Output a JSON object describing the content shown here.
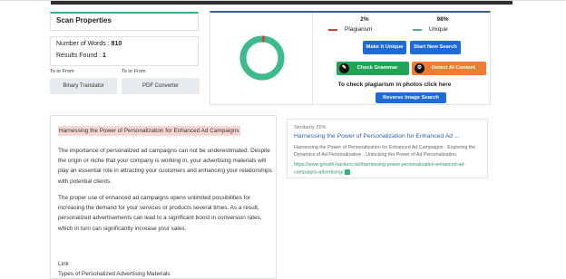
{
  "scan": {
    "title": "Scan Properties",
    "words_label": "Number of Words : ",
    "words_value": "810",
    "results_label": "Results Found : ",
    "results_value": "1",
    "to_or_from": "To or From",
    "binary_translator": "Binary Translator",
    "pdf_converter": "PDF Converter"
  },
  "results": {
    "plagiarism_pct": "2%",
    "unique_pct": "98%",
    "plagiarism_fraction": 0.02,
    "plagiarism_label": "Plagiarism",
    "unique_label": "Unique",
    "make_unique": "Make it Unique",
    "start_new_search": "Start New Search",
    "check_grammar": "Check Grammar",
    "detect_ai": "Detect AI Content",
    "photo_text": "To check plagiarism in photos click here",
    "reverse_image_search": "Reverse Image Search",
    "colors": {
      "plagiarism": "#e53935",
      "unique": "#3dbb8c",
      "blue_button": "#1e6bd6",
      "green_button": "#21a456",
      "orange_button": "#f07c32"
    }
  },
  "content": {
    "highlight": "Harnessing the Power of Personalization for Enhanced Ad Campaigns",
    "para1": "The importance of personalized ad campaigns can not be underestimated. Despite the origin or niche that your company is working in, your advertising materials will play an essential role in attracting your customers and enhancing your relationships with potential clients.",
    "para2": "The proper use of enhanced ad campaigns opens unlimited possibilities for increasing the demand for your services or products several times. As a result, personalized advertisements can lead to a significant boost in conversion rates, which in turn can significantly increase your sales.",
    "link": "Link",
    "types": "Types of Personalized Advertising Materials"
  },
  "similarity": {
    "label": "Similarity 25%",
    "title": "Harnessing the Power of Personalization for Enhanced Ad ...",
    "snippet": "Harnessing the Power of Personalization for Enhanced Ad Campaigns · Exploring the Dynamics of Ad Personalization · Unlocking the Power of Ad Personalization.",
    "url": "https://www.growth-hackers.net/harnessing-power-personalization-enhanced-ad-campaigns-advertising/"
  }
}
